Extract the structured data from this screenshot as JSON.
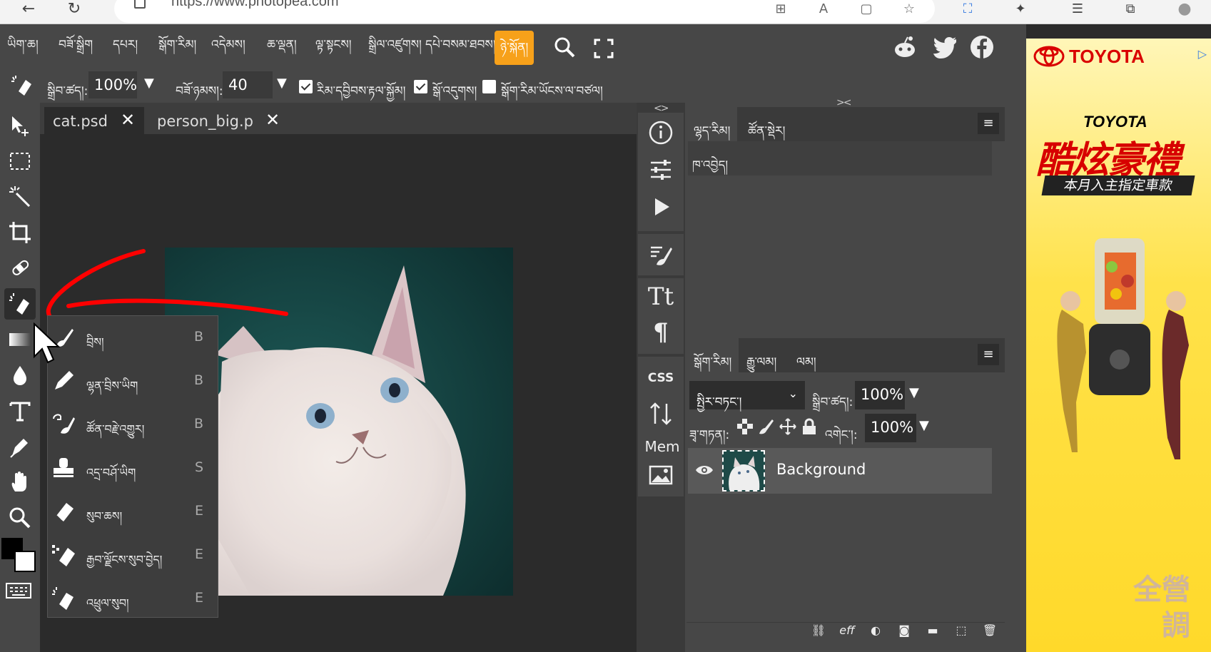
{
  "browser": {
    "url": "https://www.photopea.com"
  },
  "menubar": {
    "items": [
      "ཡིག་ཆ།",
      "བཟོ་སྒྲིག",
      "དཔར།",
      "སྒོག་རིམ།",
      "འདེམས།",
      "ཆ་ལྡན།",
      "ལྟ་སྟངས།",
      "སྒྲིལ་འཛུགས།",
      "དཔེ་བསམ་ཐབས།",
      "ཉེ་སྐོན།"
    ],
    "active_index": 9
  },
  "options": {
    "size_label": "སྒྲིབ་ཚད།:",
    "size_value": "100%",
    "flow_label": "བཟོ་ཉམས།:",
    "flow_value": "40",
    "check1_label": "རིམ་དབྱིབས་རྟལ་སྐྱོམ།",
    "check2_label": "སྒོ་འདུགས།",
    "check3_label": "སྒོག་རིམ་ཡོངས་ལ་བཙལ།"
  },
  "tabs": [
    {
      "label": "cat.psd",
      "active": true
    },
    {
      "label": "person_big.p",
      "active": false
    }
  ],
  "flyout": {
    "items": [
      {
        "label": "བྲིས།",
        "key": "B",
        "icon": "brush-icon"
      },
      {
        "label": "ལྷན་བྲིས་ཡིག",
        "key": "B",
        "icon": "pencil-icon"
      },
      {
        "label": "ཚོན་བརྗེ་འགྱུར།",
        "key": "B",
        "icon": "color-replace-icon"
      },
      {
        "label": "འདྲ་བཤོ་ཡིག",
        "key": "S",
        "icon": "clone-stamp-icon"
      },
      {
        "label": "སུབ་ཆས།",
        "key": "E",
        "icon": "eraser-icon"
      },
      {
        "label": "རྒྱབ་ལྗོངས་སུབ་བྱེད།",
        "key": "E",
        "icon": "background-eraser-icon"
      },
      {
        "label": "འཕྲུལ་སུབ།",
        "key": "E",
        "icon": "magic-eraser-icon"
      }
    ]
  },
  "mid": {
    "mem_label": "Mem",
    "css_label": "CSS",
    "collapse_left": "<>",
    "collapse_right": "><"
  },
  "history_panel": {
    "tabs": [
      "ལྷད་རིམ།",
      "ཚོན་སྡེར།"
    ],
    "row": "ཁ་འབྱེད།"
  },
  "layers_panel": {
    "tabs": [
      "སྒོག་རིམ།",
      "རྒྱུ་ལམ།",
      "ལམ།"
    ],
    "blend_mode": "སྤྱིར་བཏང་།",
    "opacity_label": "སྒྲིབ་ཚད།:",
    "opacity_value": "100%",
    "lock_label": "ཟྭ་གཏན།:",
    "fill_label": "འགེང་།:",
    "fill_value": "100%",
    "layer_name": "Background"
  },
  "ad": {
    "brand": "TOYOTA",
    "subbrand": "TOYOTA",
    "headline": "酷炫豪禮",
    "tagline": "本月入主指定車款",
    "footer1": "全營",
    "footer2": "調"
  }
}
